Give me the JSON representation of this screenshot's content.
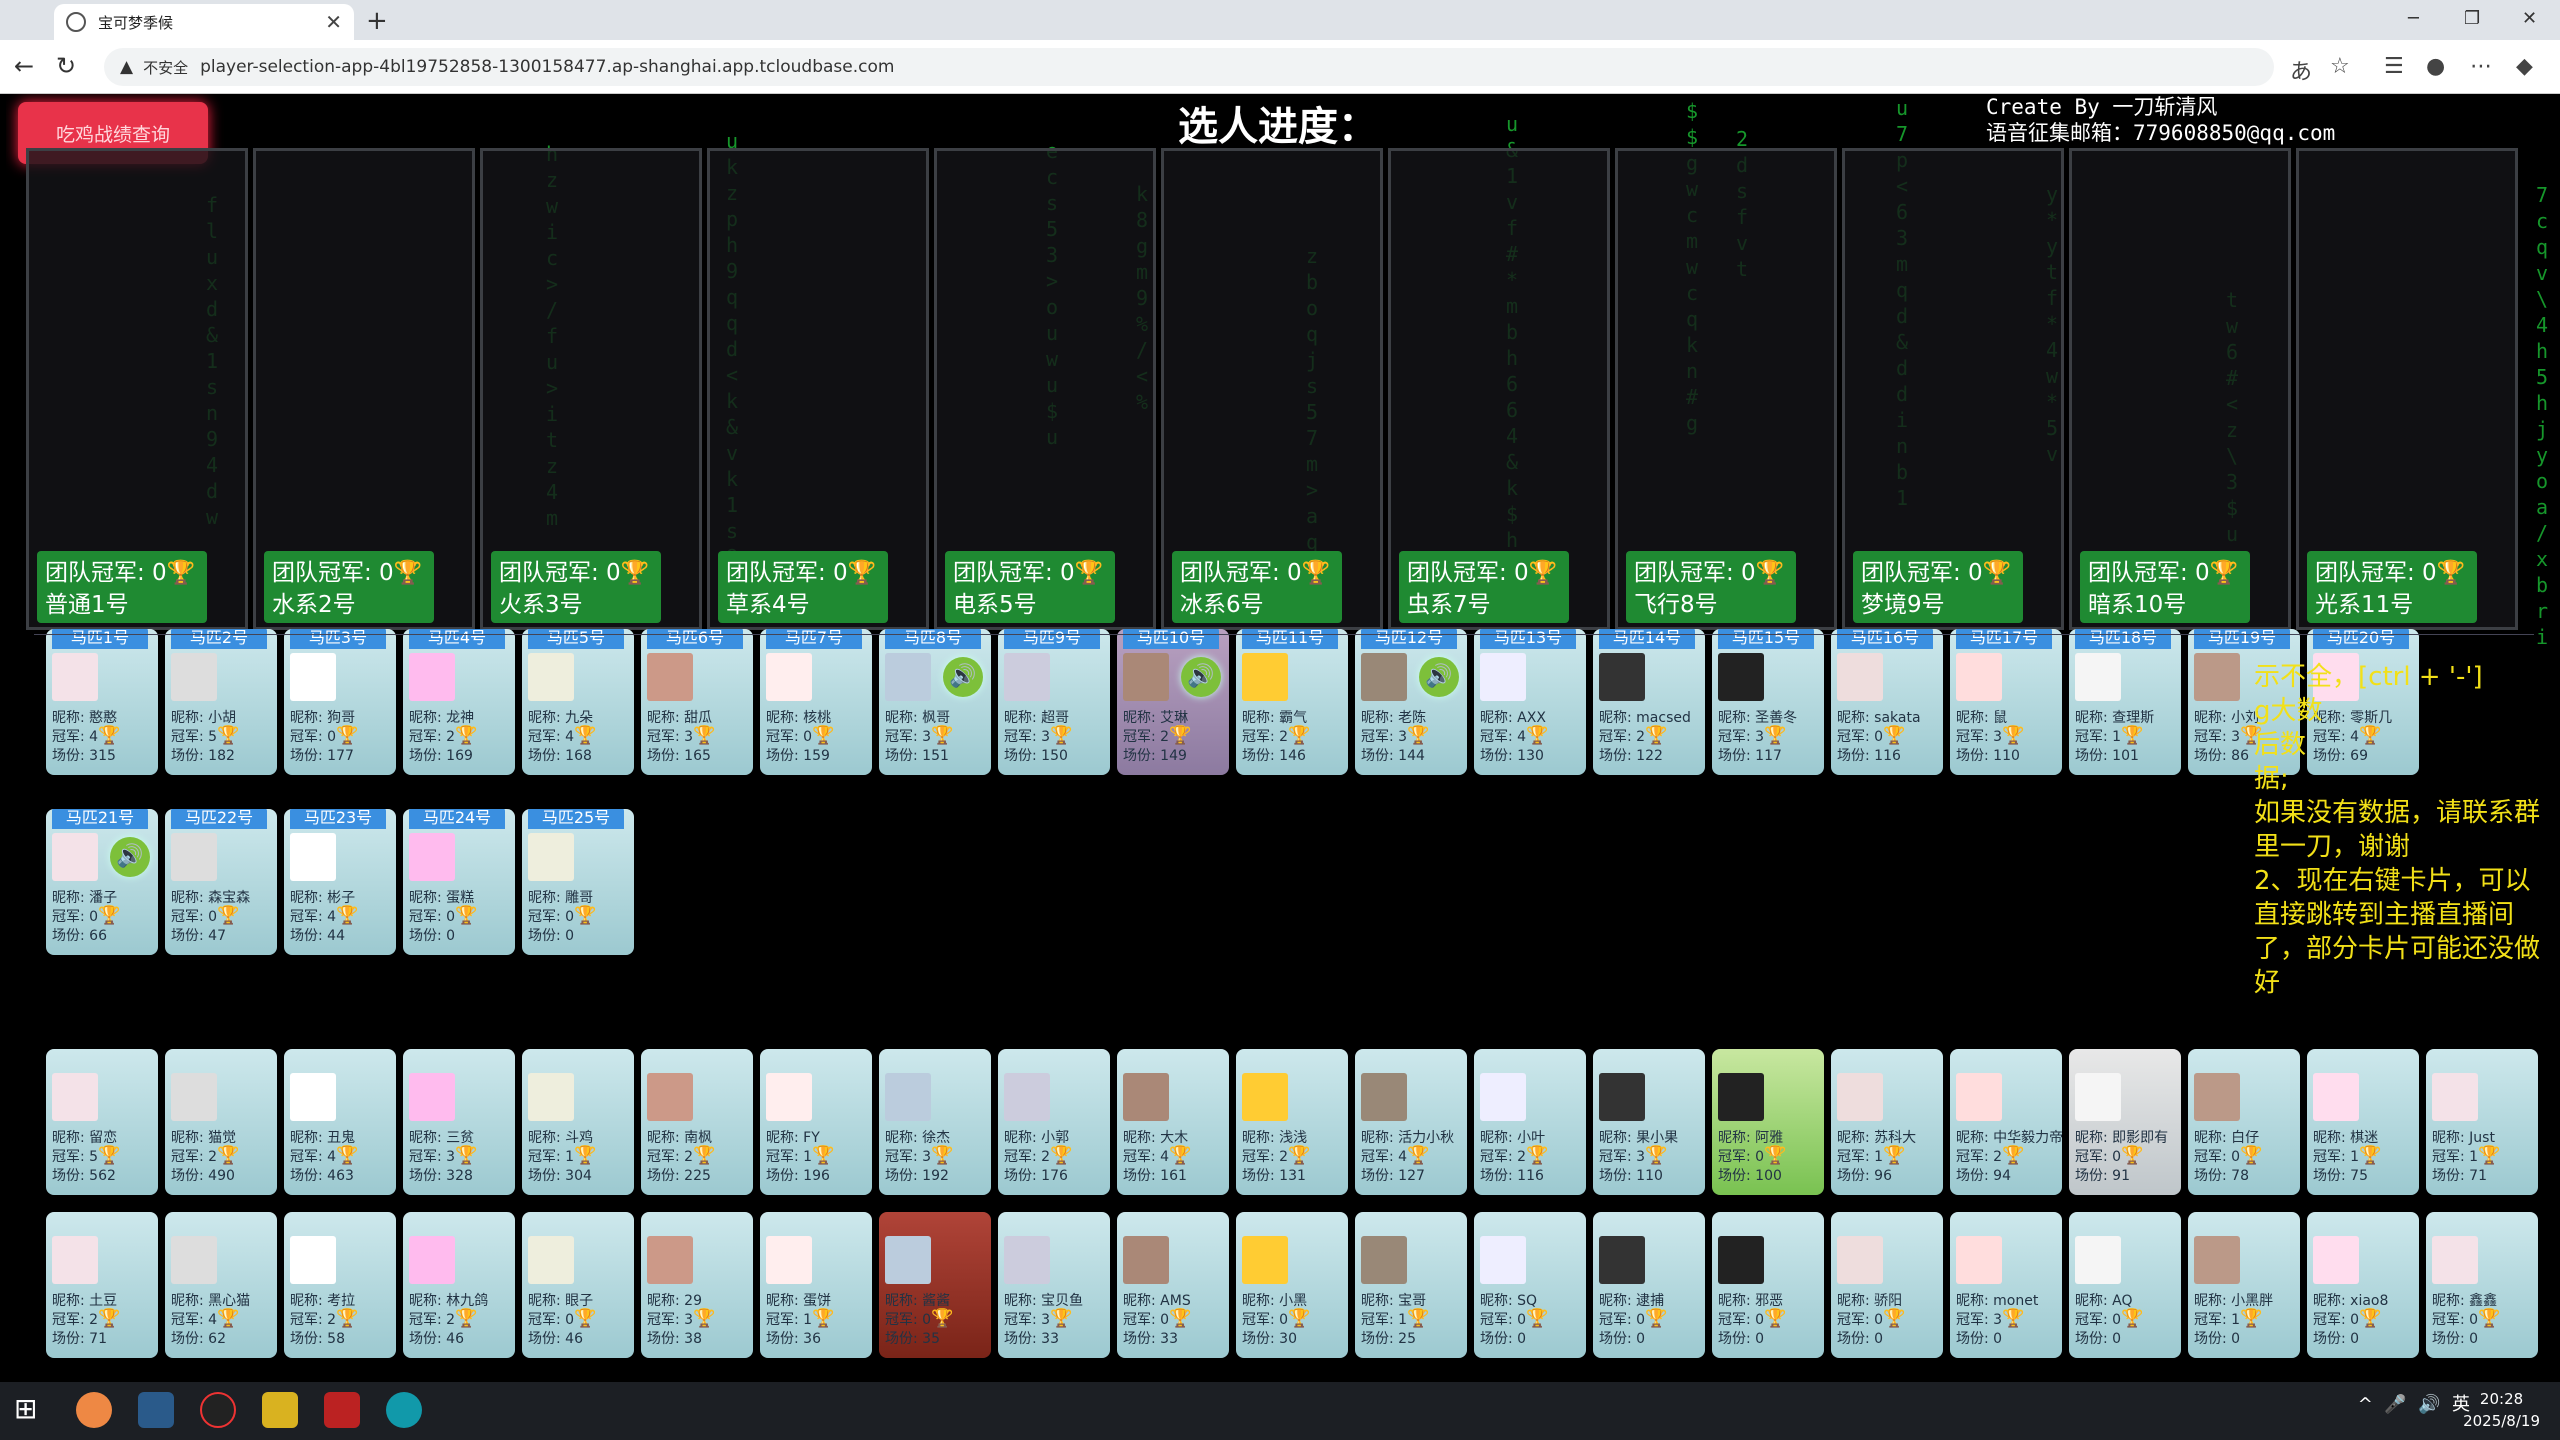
{
  "browser": {
    "tab_title": "宝可梦季候",
    "insecure_label": "不安全",
    "url": "player-selection-app-4bl19752858-1300158477.ap-shanghai.app.tcloudbase.com",
    "close_glyph": "✕",
    "newtab_glyph": "+",
    "warn_glyph": "▲"
  },
  "page": {
    "query_button": "吃鸡战绩查询",
    "title": "选人进度：",
    "credit_line1": "Create By 一刀斩清风",
    "credit_line2": "语音征集邮箱：779608850@qq.com"
  },
  "teams": [
    {
      "score": "团队冠军: 0",
      "name": "普通1号"
    },
    {
      "score": "团队冠军: 0",
      "name": "水系2号"
    },
    {
      "score": "团队冠军: 0",
      "name": "火系3号"
    },
    {
      "score": "团队冠军: 0",
      "name": "草系4号"
    },
    {
      "score": "团队冠军: 0",
      "name": "电系5号"
    },
    {
      "score": "团队冠军: 0",
      "name": "冰系6号"
    },
    {
      "score": "团队冠军: 0",
      "name": "虫系7号"
    },
    {
      "score": "团队冠军: 0",
      "name": "飞行8号"
    },
    {
      "score": "团队冠军: 0",
      "name": "梦境9号"
    },
    {
      "score": "团队冠军: 0",
      "name": "暗系10号"
    },
    {
      "score": "团队冠军: 0",
      "name": "光系11号"
    }
  ],
  "horses": [
    {
      "tag": "马匹1号",
      "name": "昵称: 憨憨",
      "champ": "冠军: 4",
      "games": "场份: 315",
      "voice": false
    },
    {
      "tag": "马匹2号",
      "name": "昵称: 小胡",
      "champ": "冠军: 5",
      "games": "场份: 182",
      "voice": false
    },
    {
      "tag": "马匹3号",
      "name": "昵称: 狗哥",
      "champ": "冠军: 0",
      "games": "场份: 177",
      "voice": false
    },
    {
      "tag": "马匹4号",
      "name": "昵称: 龙神",
      "champ": "冠军: 2",
      "games": "场份: 169",
      "voice": false
    },
    {
      "tag": "马匹5号",
      "name": "昵称: 九朵",
      "champ": "冠军: 4",
      "games": "场份: 168",
      "voice": false
    },
    {
      "tag": "马匹6号",
      "name": "昵称: 甜瓜",
      "champ": "冠军: 3",
      "games": "场份: 165",
      "voice": false
    },
    {
      "tag": "马匹7号",
      "name": "昵称: 核桃",
      "champ": "冠军: 0",
      "games": "场份: 159",
      "voice": false
    },
    {
      "tag": "马匹8号",
      "name": "昵称: 枫哥",
      "champ": "冠军: 3",
      "games": "场份: 151",
      "voice": true
    },
    {
      "tag": "马匹9号",
      "name": "昵称: 超哥",
      "champ": "冠军: 3",
      "games": "场份: 150",
      "voice": false
    },
    {
      "tag": "马匹10号",
      "name": "昵称: 艾琳",
      "champ": "冠军: 2",
      "games": "场份: 149",
      "voice": true
    },
    {
      "tag": "马匹11号",
      "name": "昵称: 霸气",
      "champ": "冠军: 2",
      "games": "场份: 146",
      "voice": false
    },
    {
      "tag": "马匹12号",
      "name": "昵称: 老陈",
      "champ": "冠军: 3",
      "games": "场份: 144",
      "voice": true
    },
    {
      "tag": "马匹13号",
      "name": "昵称: AXX",
      "champ": "冠军: 4",
      "games": "场份: 130",
      "voice": false
    },
    {
      "tag": "马匹14号",
      "name": "昵称: macsed",
      "champ": "冠军: 2",
      "games": "场份: 122",
      "voice": false
    },
    {
      "tag": "马匹15号",
      "name": "昵称: 圣善冬",
      "champ": "冠军: 3",
      "games": "场份: 117",
      "voice": false
    },
    {
      "tag": "马匹16号",
      "name": "昵称: sakata",
      "champ": "冠军: 0",
      "games": "场份: 116",
      "voice": false
    },
    {
      "tag": "马匹17号",
      "name": "昵称: 鼠",
      "champ": "冠军: 3",
      "games": "场份: 110",
      "voice": false
    },
    {
      "tag": "马匹18号",
      "name": "昵称: 查理斯",
      "champ": "冠军: 1",
      "games": "场份: 101",
      "voice": false
    },
    {
      "tag": "马匹19号",
      "name": "昵称: 小刘",
      "champ": "冠军: 3",
      "games": "场份: 86",
      "voice": false
    },
    {
      "tag": "马匹20号",
      "name": "昵称: 零斯几",
      "champ": "冠军: 4",
      "games": "场份: 69",
      "voice": false
    },
    {
      "tag": "马匹21号",
      "name": "昵称: 潘子",
      "champ": "冠军: 0",
      "games": "场份: 66",
      "voice": true
    },
    {
      "tag": "马匹22号",
      "name": "昵称: 森宝森",
      "champ": "冠军: 0",
      "games": "场份: 47",
      "voice": false
    },
    {
      "tag": "马匹23号",
      "name": "昵称: 彬子",
      "champ": "冠军: 4",
      "games": "场份: 44",
      "voice": false
    },
    {
      "tag": "马匹24号",
      "name": "昵称: 蛋糕",
      "champ": "冠军: 0",
      "games": "场份: 0",
      "voice": false
    },
    {
      "tag": "马匹25号",
      "name": "昵称: 雕哥",
      "champ": "冠军: 0",
      "games": "场份: 0",
      "voice": false
    }
  ],
  "players_row1": [
    {
      "name": "昵称: 留恋",
      "champ": "冠军: 5",
      "games": "场份: 562"
    },
    {
      "name": "昵称: 猫觉",
      "champ": "冠军: 2",
      "games": "场份: 490"
    },
    {
      "name": "昵称: 丑鬼",
      "champ": "冠军: 4",
      "games": "场份: 463"
    },
    {
      "name": "昵称: 三贫",
      "champ": "冠军: 3",
      "games": "场份: 328"
    },
    {
      "name": "昵称: 斗鸡",
      "champ": "冠军: 1",
      "games": "场份: 304"
    },
    {
      "name": "昵称: 南枫",
      "champ": "冠军: 2",
      "games": "场份: 225"
    },
    {
      "name": "昵称: FY",
      "champ": "冠军: 1",
      "games": "场份: 196"
    },
    {
      "name": "昵称: 徐杰",
      "champ": "冠军: 3",
      "games": "场份: 192"
    },
    {
      "name": "昵称: 小郭",
      "champ": "冠军: 2",
      "games": "场份: 176"
    },
    {
      "name": "昵称: 大木",
      "champ": "冠军: 4",
      "games": "场份: 161"
    },
    {
      "name": "昵称: 浅浅",
      "champ": "冠军: 2",
      "games": "场份: 131"
    },
    {
      "name": "昵称: 活力小秋",
      "champ": "冠军: 4",
      "games": "场份: 127"
    },
    {
      "name": "昵称: 小叶",
      "champ": "冠军: 2",
      "games": "场份: 116"
    },
    {
      "name": "昵称: 果小果",
      "champ": "冠军: 3",
      "games": "场份: 110"
    },
    {
      "name": "昵称: 阿雅",
      "champ": "冠军: 0",
      "games": "场份: 100"
    },
    {
      "name": "昵称: 苏科大",
      "champ": "冠军: 1",
      "games": "场份: 96"
    },
    {
      "name": "昵称: 中华毅力帝",
      "champ": "冠军: 2",
      "games": "场份: 94"
    },
    {
      "name": "昵称: 即影即有",
      "champ": "冠军: 0",
      "games": "场份: 91"
    },
    {
      "name": "昵称: 白仔",
      "champ": "冠军: 0",
      "games": "场份: 78"
    },
    {
      "name": "昵称: 棋迷",
      "champ": "冠军: 1",
      "games": "场份: 75"
    },
    {
      "name": "昵称: Just",
      "champ": "冠军: 1",
      "games": "场份: 71"
    }
  ],
  "players_row2": [
    {
      "name": "昵称: 土豆",
      "champ": "冠军: 2",
      "games": "场份: 71"
    },
    {
      "name": "昵称: 黑心猫",
      "champ": "冠军: 4",
      "games": "场份: 62"
    },
    {
      "name": "昵称: 考拉",
      "champ": "冠军: 2",
      "games": "场份: 58"
    },
    {
      "name": "昵称: 林九鸽",
      "champ": "冠军: 2",
      "games": "场份: 46"
    },
    {
      "name": "昵称: 眼子",
      "champ": "冠军: 0",
      "games": "场份: 46"
    },
    {
      "name": "昵称: 29",
      "champ": "冠军: 3",
      "games": "场份: 38"
    },
    {
      "name": "昵称: 蛋饼",
      "champ": "冠军: 1",
      "games": "场份: 36"
    },
    {
      "name": "昵称: 酱酱",
      "champ": "冠军: 0",
      "games": "场份: 35"
    },
    {
      "name": "昵称: 宝贝鱼",
      "champ": "冠军: 3",
      "games": "场份: 33"
    },
    {
      "name": "昵称: AMS",
      "champ": "冠军: 0",
      "games": "场份: 33"
    },
    {
      "name": "昵称: 小黑",
      "champ": "冠军: 0",
      "games": "场份: 30"
    },
    {
      "name": "昵称: 宝哥",
      "champ": "冠军: 1",
      "games": "场份: 25"
    },
    {
      "name": "昵称: SQ",
      "champ": "冠军: 0",
      "games": "场份: 0"
    },
    {
      "name": "昵称: 逮捕",
      "champ": "冠军: 0",
      "games": "场份: 0"
    },
    {
      "name": "昵称: 邪恶",
      "champ": "冠军: 0",
      "games": "场份: 0"
    },
    {
      "name": "昵称: 骄阳",
      "champ": "冠军: 0",
      "games": "场份: 0"
    },
    {
      "name": "昵称: monet",
      "champ": "冠军: 3",
      "games": "场份: 0"
    },
    {
      "name": "昵称: AQ",
      "champ": "冠军: 0",
      "games": "场份: 0"
    },
    {
      "name": "昵称: 小黑胖",
      "champ": "冠军: 1",
      "games": "场份: 0"
    },
    {
      "name": "昵称: xiao8",
      "champ": "冠军: 0",
      "games": "场份: 0"
    },
    {
      "name": "昵称: 鑫鑫",
      "champ": "冠军: 0",
      "games": "场份: 0"
    }
  ],
  "note": {
    "line1": "示不全，[ctrl + '-']",
    "line2": "g大数",
    "line3": "后数",
    "line4": "据;",
    "line5": "如果没有数据，请联系群里一刀，谢谢",
    "line6": "2、现在右键卡片，可以直接跳转到主播直播间了，部分卡片可能还没做好"
  },
  "taskbar": {
    "time": "20:28",
    "date": "2025/8/19",
    "ime": "英"
  },
  "colors": {
    "rain": "#1ec93a",
    "team_badge": "#1f8a32",
    "tag": "#3a8fe0",
    "note": "#f2e018"
  }
}
